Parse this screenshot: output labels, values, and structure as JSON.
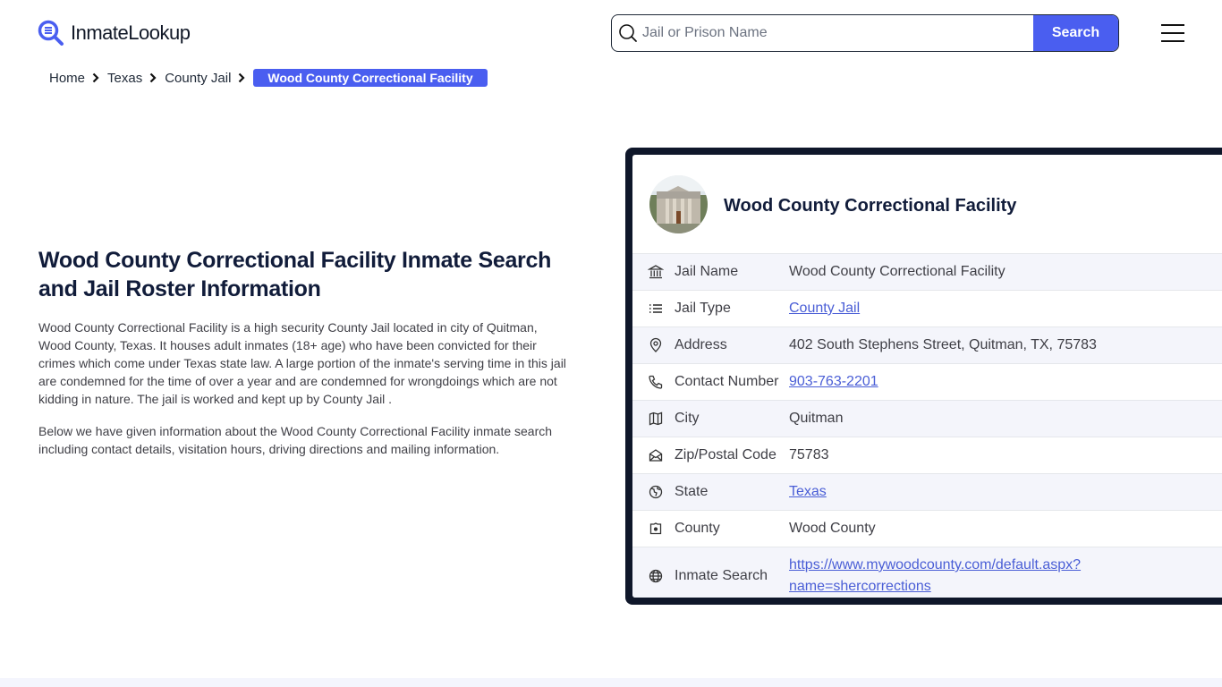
{
  "header": {
    "logo_text": "InmateLookup",
    "search": {
      "placeholder": "Jail or Prison Name",
      "value": "",
      "button_label": "Search"
    },
    "brand_color": "#4a5ef0"
  },
  "breadcrumb": {
    "items": [
      "Home",
      "Texas",
      "County Jail"
    ],
    "current": "Wood County Correctional Facility"
  },
  "intro": {
    "title": "Wood County Correctional Facility Inmate Search and Jail Roster Information",
    "paragraphs": [
      "Wood County Correctional Facility is a high security County Jail located in city of Quitman, Wood County, Texas. It houses adult inmates (18+ age) who have been convicted for their crimes which come under Texas state law. A large portion of the inmate's serving time in this jail are condemned for the time of over a year and are condemned for wrongdoings which are not kidding in nature. The jail is worked and kept up by County Jail .",
      "Below we have given information about the Wood County Correctional Facility inmate search including contact details, visitation hours, driving directions and mailing information."
    ]
  },
  "card": {
    "title": "Wood County Correctional Facility",
    "rows": [
      {
        "icon": "building-columns-icon",
        "label": "Jail Name",
        "value": "Wood County Correctional Facility",
        "link": false
      },
      {
        "icon": "list-icon",
        "label": "Jail Type",
        "value": "County Jail",
        "link": true
      },
      {
        "icon": "map-pin-icon",
        "label": "Address",
        "value": "402 South Stephens Street, Quitman, TX, 75783",
        "link": false
      },
      {
        "icon": "phone-icon",
        "label": "Contact Number",
        "value": "903-763-2201",
        "link": true
      },
      {
        "icon": "map-icon",
        "label": "City",
        "value": "Quitman",
        "link": false
      },
      {
        "icon": "mail-open-icon",
        "label": "Zip/Postal Code",
        "value": "75783",
        "link": false
      },
      {
        "icon": "globe-region-icon",
        "label": "State",
        "value": "Texas",
        "link": true
      },
      {
        "icon": "county-shape-icon",
        "label": "County",
        "value": "Wood County",
        "link": false
      },
      {
        "icon": "globe-icon",
        "label": "Inmate Search",
        "value": "https://www.mywoodcounty.com/default.aspx?name=shercorrections",
        "value_lines": [
          "https://www.mywoodcounty.com/default.aspx?",
          "name=shercorrections"
        ],
        "link": true
      }
    ]
  }
}
